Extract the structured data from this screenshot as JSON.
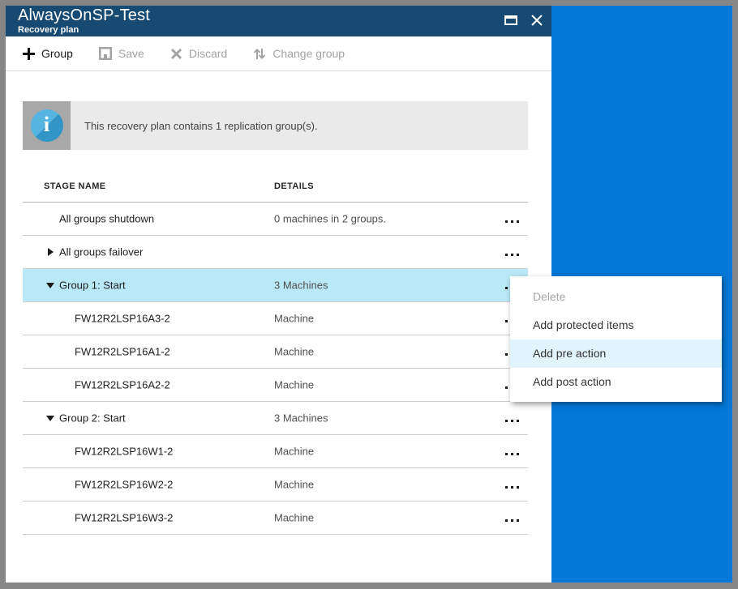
{
  "window": {
    "title": "AlwaysOnSP-Test",
    "subtitle": "Recovery plan"
  },
  "toolbar": {
    "group_label": "Group",
    "save_label": "Save",
    "discard_label": "Discard",
    "change_group_label": "Change group"
  },
  "banner": {
    "text": "This recovery plan contains 1 replication group(s)."
  },
  "icons": {
    "info_glyph": "i"
  },
  "table": {
    "columns": [
      "STAGE NAME",
      "DETAILS"
    ],
    "rows": [
      {
        "name": "All groups shutdown",
        "details": "0 machines in 2 groups."
      },
      {
        "name": "All groups failover",
        "details": ""
      },
      {
        "name": "Group 1: Start",
        "details": "3 Machines"
      },
      {
        "name": "FW12R2LSP16A3-2",
        "details": "Machine"
      },
      {
        "name": "FW12R2LSP16A1-2",
        "details": "Machine"
      },
      {
        "name": "FW12R2LSP16A2-2",
        "details": "Machine"
      },
      {
        "name": "Group 2: Start",
        "details": "3 Machines"
      },
      {
        "name": "FW12R2LSP16W1-2",
        "details": "Machine"
      },
      {
        "name": "FW12R2LSP16W2-2",
        "details": "Machine"
      },
      {
        "name": "FW12R2LSP16W3-2",
        "details": "Machine"
      }
    ]
  },
  "context_menu": {
    "items": [
      {
        "label": "Delete"
      },
      {
        "label": "Add protected items"
      },
      {
        "label": "Add pre action"
      },
      {
        "label": "Add post action"
      }
    ]
  },
  "colors": {
    "blade_header": "#164a72",
    "portal_background": "#0078d7",
    "selected_row": "#b9e9f6",
    "menu_hover": "#e1f3fb",
    "frame_gray": "#868686",
    "banner_bg": "#eaeaea",
    "banner_icon_box": "#a8a8a8",
    "info_icon_blue": "#3fa5d6"
  }
}
